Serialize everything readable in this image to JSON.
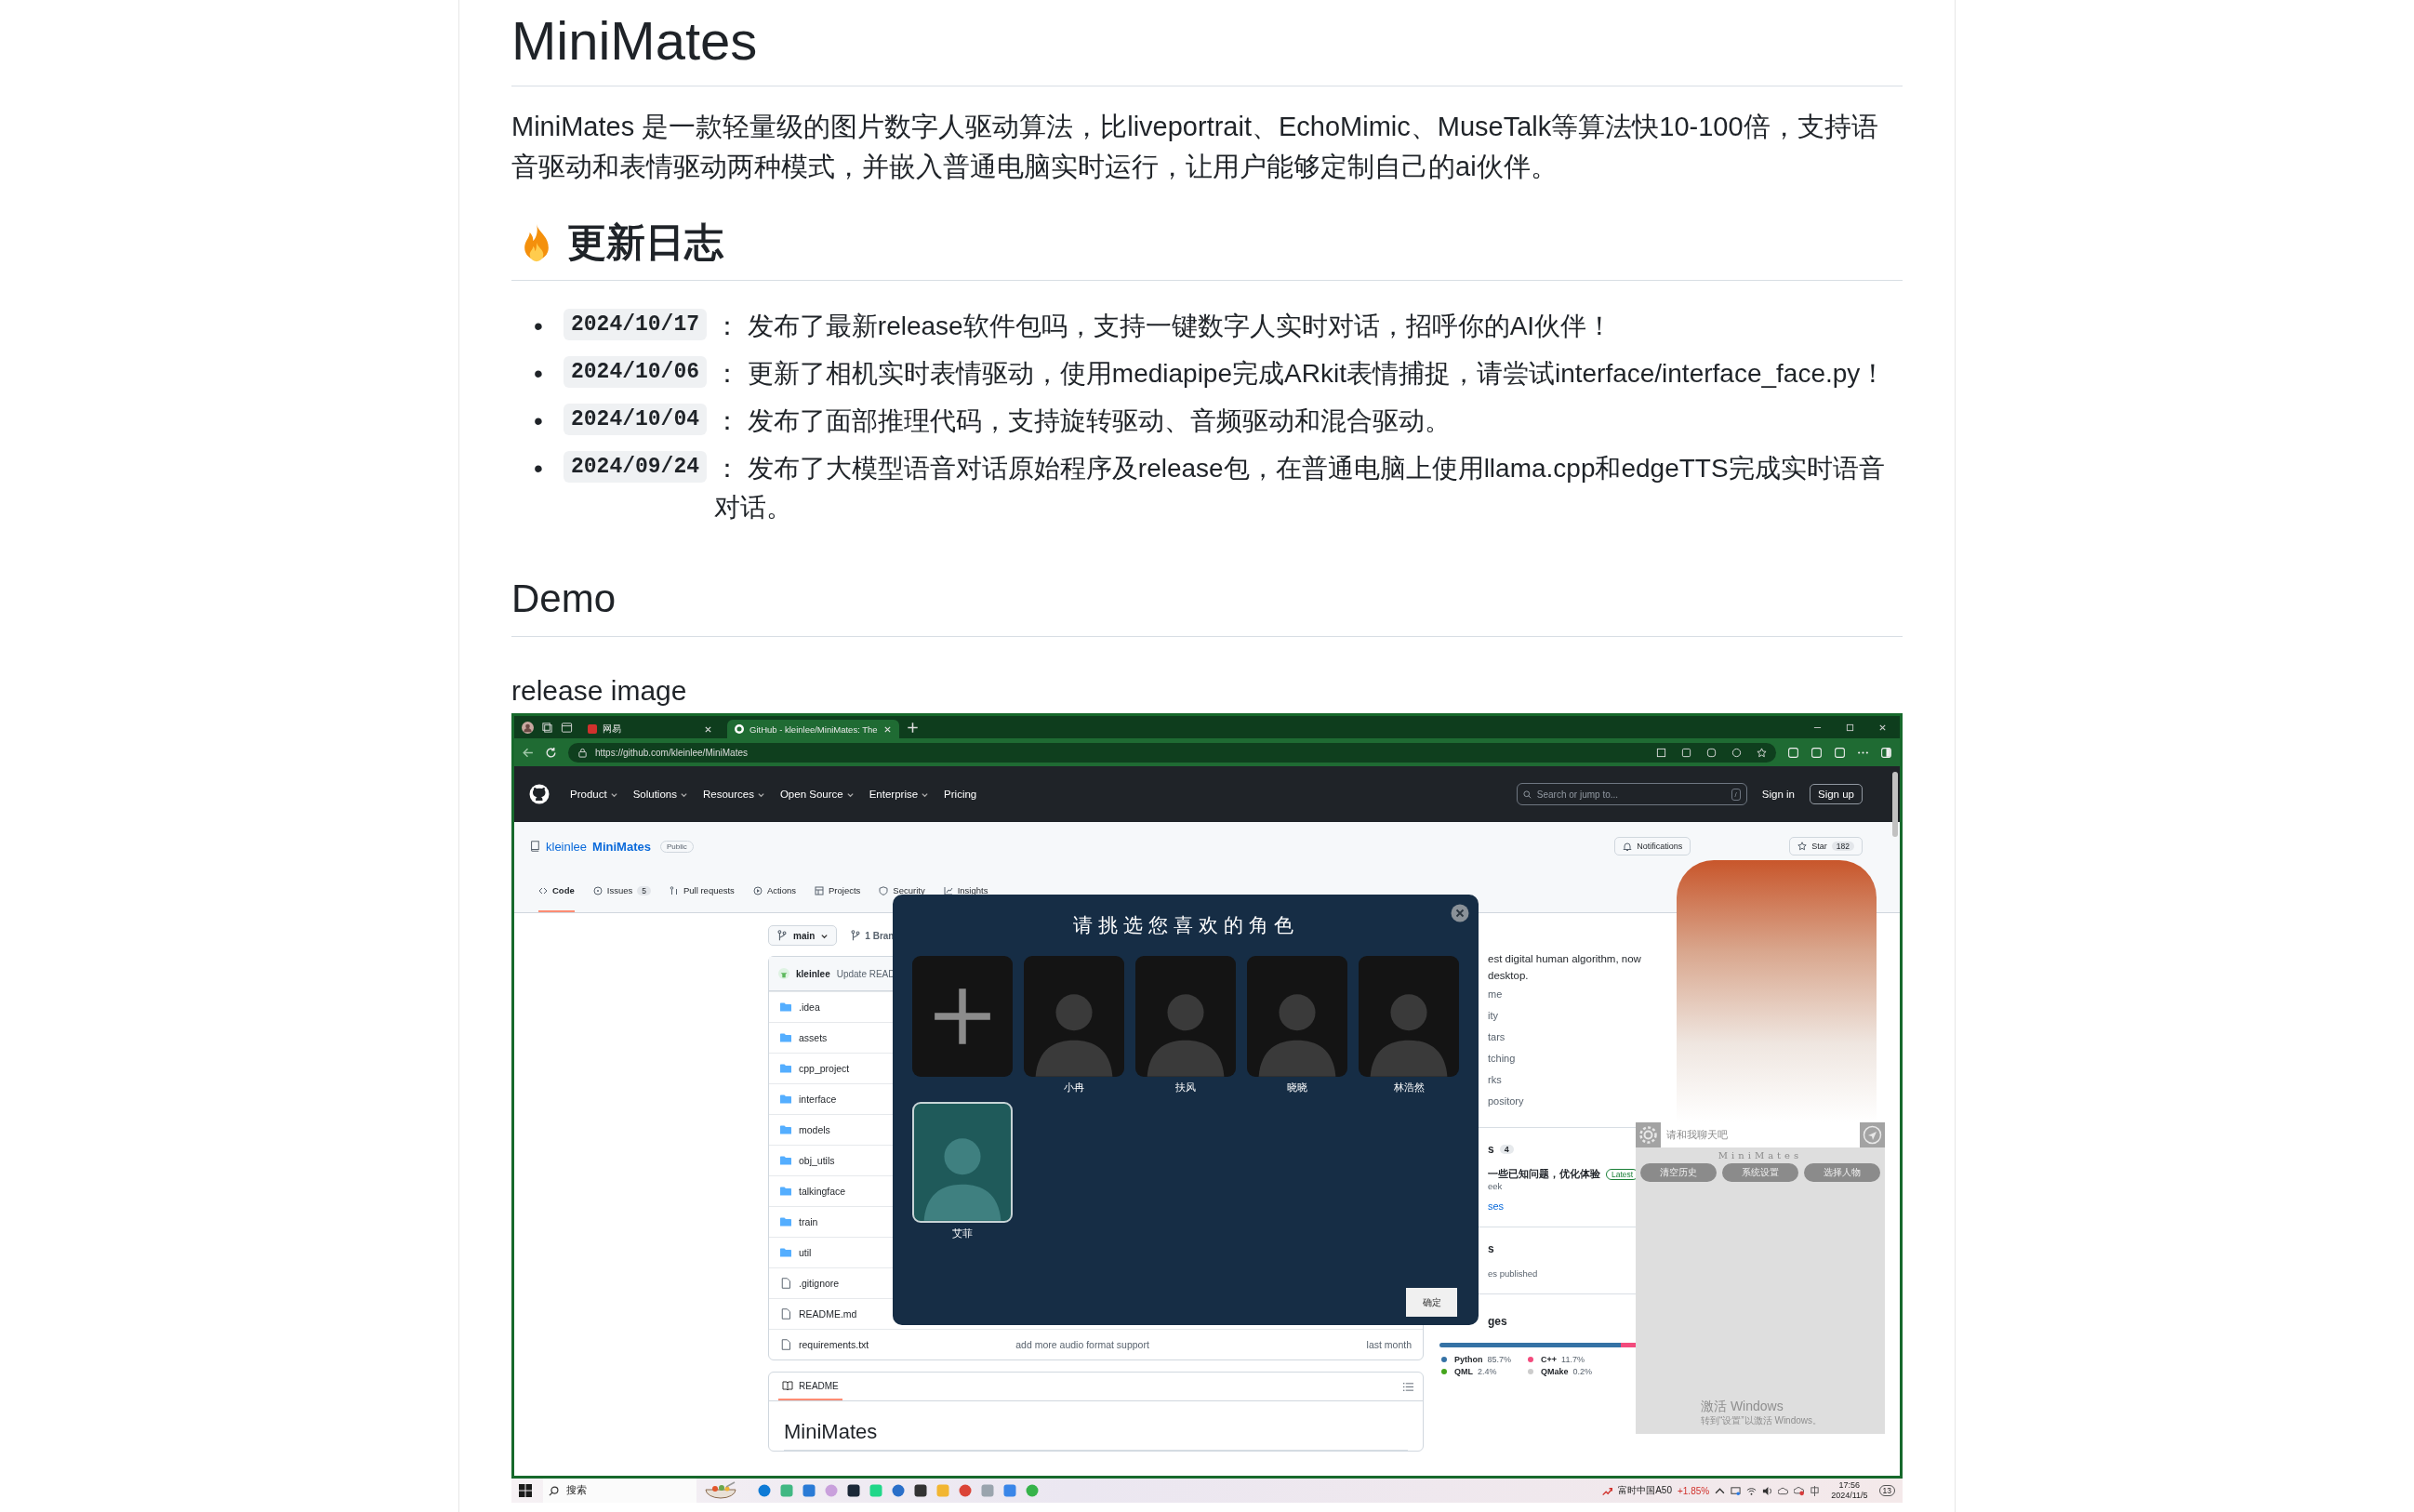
{
  "readme": {
    "title": "MiniMates",
    "intro": "MiniMates 是一款轻量级的图片数字人驱动算法，比liveportrait、EchoMimic、MuseTalk等算法快10-100倍，支持语音驱动和表情驱动两种模式，并嵌入普通电脑实时运行，让用户能够定制自己的ai伙伴。",
    "changelog": {
      "heading": "更新日志",
      "entries": [
        {
          "marker": "•",
          "date": "2024/10/17",
          "text": "： 发布了最新release软件包吗，支持一键数字人实时对话，招呼你的AI伙伴！"
        },
        {
          "marker": "•",
          "date": "2024/10/06",
          "text": "： 更新了相机实时表情驱动，使用mediapipe完成ARkit表情捕捉，请尝试interface/interface_face.py！"
        },
        {
          "marker": "•",
          "date": "2024/10/04",
          "text": "： 发布了面部推理代码，支持旋转驱动、音频驱动和混合驱动。"
        },
        {
          "marker": "•",
          "date": "2024/09/24",
          "text": "： 发布了大模型语音对话原始程序及release包，在普通电脑上使用llama.cpp和edgeTTS完成实时语音对话。"
        }
      ]
    },
    "demo": {
      "heading": "Demo",
      "caption": "release image"
    }
  },
  "screenshot": {
    "browser": {
      "tabs": [
        {
          "title": "网易",
          "selected": false
        },
        {
          "title": "GitHub - kleinlee/MiniMates: The",
          "selected": true
        }
      ],
      "url": "https://github.com/kleinlee/MiniMates"
    },
    "github": {
      "nav": [
        "Product",
        "Solutions",
        "Resources",
        "Open Source",
        "Enterprise",
        "Pricing"
      ],
      "search_placeholder": "Search or jump to...",
      "search_key": "/",
      "sign_in": "Sign in",
      "sign_up": "Sign up",
      "owner": "kleinlee",
      "repo": "MiniMates",
      "visibility": "Public",
      "notifications": "Notifications",
      "star": "Star",
      "star_count": "182",
      "tabs": [
        {
          "label": "Code",
          "selected": true
        },
        {
          "label": "Issues",
          "count": "5",
          "selected": false
        },
        {
          "label": "Pull requests",
          "selected": false
        },
        {
          "label": "Actions",
          "selected": false
        },
        {
          "label": "Projects",
          "selected": false
        },
        {
          "label": "Security",
          "selected": false
        },
        {
          "label": "Insights",
          "selected": false
        }
      ],
      "branch": "main",
      "branches": "1 Bran",
      "commit_author": "kleinlee",
      "commit_message": "Update READ",
      "files": [
        {
          "kind": "folder",
          "name": ".idea"
        },
        {
          "kind": "folder",
          "name": "assets"
        },
        {
          "kind": "folder",
          "name": "cpp_project"
        },
        {
          "kind": "folder",
          "name": "interface"
        },
        {
          "kind": "folder",
          "name": "models"
        },
        {
          "kind": "folder",
          "name": "obj_utils"
        },
        {
          "kind": "folder",
          "name": "talkingface"
        },
        {
          "kind": "folder",
          "name": "train"
        },
        {
          "kind": "folder",
          "name": "util"
        },
        {
          "kind": "file",
          "name": ".gitignore"
        },
        {
          "kind": "file",
          "name": "README.md"
        },
        {
          "kind": "file",
          "name": "requirements.txt",
          "message": "add more audio format support",
          "time": "last month"
        }
      ],
      "readme_label": "README",
      "readme_title": "MiniMates",
      "about_lines": [
        "est digital human algorithm, now",
        "desktop."
      ],
      "about_links": [
        "me",
        "ity",
        "tars",
        "tching",
        "rks",
        "pository"
      ],
      "releases": {
        "heading": "s",
        "count": "4",
        "title": "一些已知问题，优化体验",
        "badge": "Latest",
        "time": "eek",
        "link": "ses"
      },
      "packages": {
        "heading": "s",
        "note": "es published"
      },
      "languages": {
        "heading": "ges",
        "items": [
          {
            "name": "Python",
            "percent": "85.7%",
            "color": "#3572a5",
            "level": 0.857
          },
          {
            "name": "C++",
            "percent": "11.7%",
            "color": "#f34b7d",
            "level": 0.117
          },
          {
            "name": "QML",
            "percent": "2.4%",
            "color": "#44a51c",
            "level": 0.024
          },
          {
            "name": "QMake",
            "percent": "0.2%",
            "color": "#cccccc",
            "level": 0.002
          }
        ]
      }
    },
    "chooser": {
      "title": "请挑选您喜欢的角色",
      "characters": [
        {
          "kind": "add",
          "selected": false
        },
        {
          "kind": "portrait",
          "name": "小冉",
          "selected": false
        },
        {
          "kind": "portrait",
          "name": "扶风",
          "selected": false
        },
        {
          "kind": "portrait",
          "name": "晓晓",
          "selected": false
        },
        {
          "kind": "portrait",
          "name": "林浩然",
          "selected": false
        },
        {
          "kind": "portrait",
          "name": "艾菲",
          "selected": true
        }
      ],
      "confirm": "确定"
    },
    "chat_widget": {
      "placeholder": "请和我聊天吧",
      "brand": "MiniMates",
      "buttons": [
        "清空历史",
        "系统设置",
        "选择人物"
      ],
      "activation_title": "激活 Windows",
      "activation_hint": "转到“设置”以激活 Windows。"
    },
    "taskbar": {
      "search": "搜索",
      "ticker": "富时中国A50",
      "change": "+1.85%",
      "time": "17:56",
      "date": "2024/11/5",
      "notifications": "13"
    }
  }
}
